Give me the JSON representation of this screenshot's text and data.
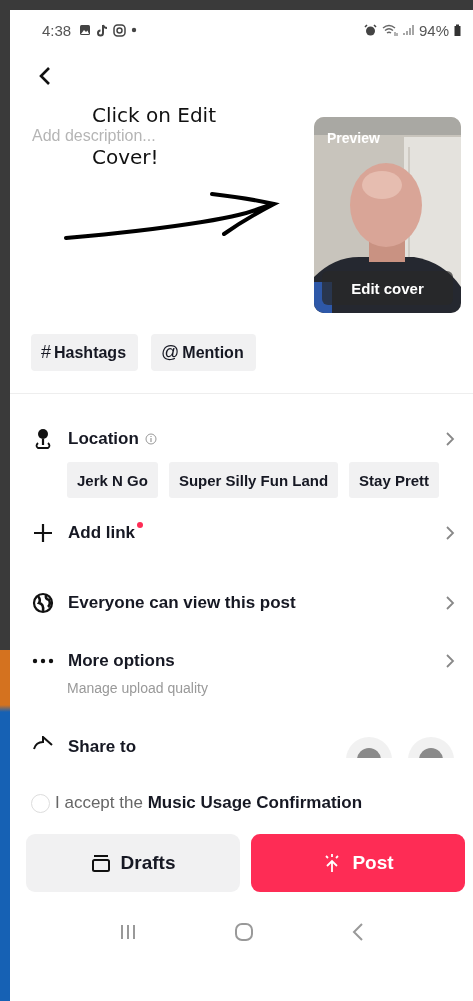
{
  "status_bar": {
    "time": "4:38",
    "battery": "94%"
  },
  "description": {
    "placeholder": "Add description..."
  },
  "annotation": {
    "lines": [
      "Click on Edit",
      "Cover!"
    ]
  },
  "preview": {
    "label": "Preview",
    "edit_button": "Edit cover"
  },
  "tag_chips": [
    {
      "symbol": "#",
      "label": "Hashtags"
    },
    {
      "symbol": "@",
      "label": "Mention"
    }
  ],
  "rows": [
    {
      "kind": "location",
      "label": "Location",
      "chips": [
        "Jerk N Go",
        "Super Silly Fun Land",
        "Stay Prett"
      ]
    },
    {
      "kind": "link",
      "label": "Add link",
      "has_dot": true
    },
    {
      "kind": "privacy",
      "label": "Everyone can view this post"
    },
    {
      "kind": "more",
      "label": "More options",
      "sub": "Manage upload quality"
    },
    {
      "kind": "share",
      "label": "Share to"
    }
  ],
  "music_confirm": {
    "checked": false,
    "text": "I accept the **Music Usage Confirmation**"
  },
  "buttons": [
    {
      "kind": "drafts",
      "label": "Drafts"
    },
    {
      "kind": "post",
      "label": "Post"
    }
  ]
}
